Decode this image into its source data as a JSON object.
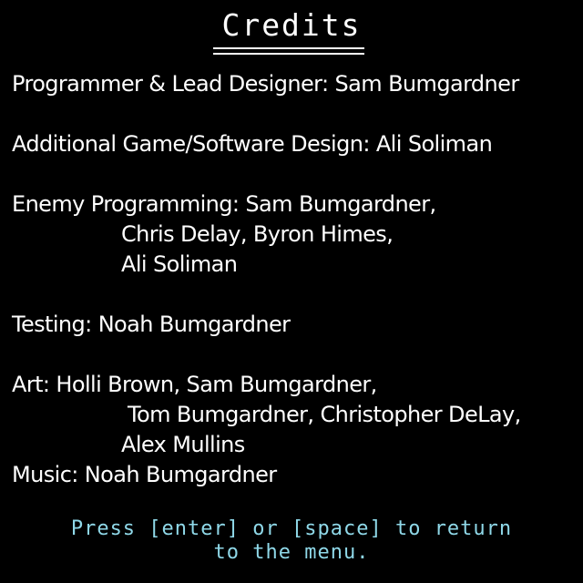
{
  "screen": {
    "title": "Credits",
    "background_color": "#000000",
    "text_color": "#ffffff",
    "prompt_color": "#8fd8e8"
  },
  "credits": {
    "programmer": "Programmer & Lead Designer: Sam Bumgardner",
    "additional_design": "Additional Game/Software Design: Ali Soliman",
    "enemy_programming": "Enemy Programming: Sam Bumgardner,",
    "enemy_programming_2": "Chris Delay, Byron Himes,",
    "enemy_programming_3": "Ali Soliman",
    "testing": "Testing: Noah Bumgardner",
    "art": "Art: Holli Brown, Sam Bumgardner,",
    "art_2": "Tom Bumgardner, Christopher DeLay,",
    "art_3": "Alex Mullins",
    "music": "Music: Noah Bumgardner"
  },
  "prompt": {
    "line1": "Press [enter] or [space] to return",
    "line2": "to the menu."
  }
}
